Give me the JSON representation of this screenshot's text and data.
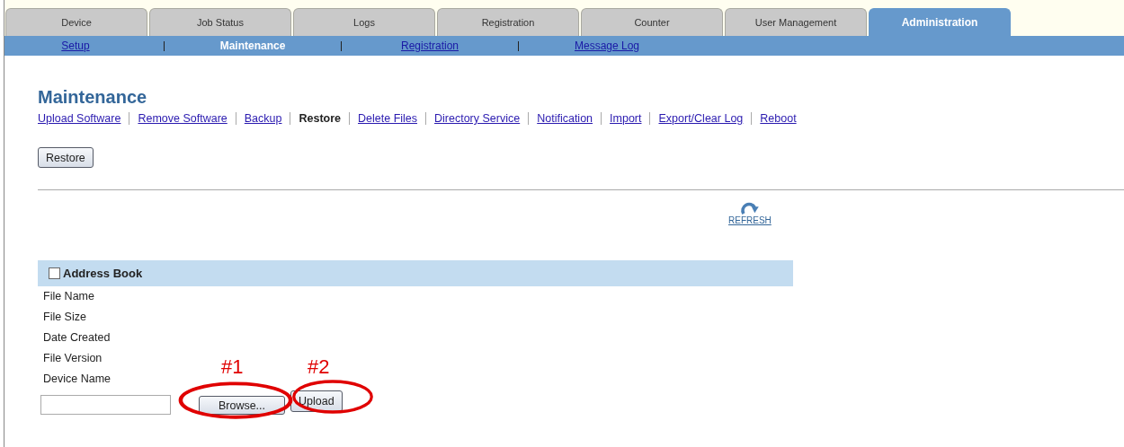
{
  "tabs": [
    {
      "label": "Device",
      "selected": false
    },
    {
      "label": "Job Status",
      "selected": false
    },
    {
      "label": "Logs",
      "selected": false
    },
    {
      "label": "Registration",
      "selected": false
    },
    {
      "label": "Counter",
      "selected": false
    },
    {
      "label": "User Management",
      "selected": false
    },
    {
      "label": "Administration",
      "selected": true
    }
  ],
  "subnav": [
    {
      "label": "Setup",
      "selected": false
    },
    {
      "label": "Maintenance",
      "selected": true
    },
    {
      "label": "Registration",
      "selected": false
    },
    {
      "label": "Message Log",
      "selected": false
    }
  ],
  "page_title": "Maintenance",
  "sublinks": [
    {
      "label": "Upload Software",
      "selected": false
    },
    {
      "label": "Remove Software",
      "selected": false
    },
    {
      "label": "Backup",
      "selected": false
    },
    {
      "label": "Restore",
      "selected": true
    },
    {
      "label": "Delete Files",
      "selected": false
    },
    {
      "label": "Directory Service",
      "selected": false
    },
    {
      "label": "Notification",
      "selected": false
    },
    {
      "label": "Import",
      "selected": false
    },
    {
      "label": "Export/Clear Log",
      "selected": false
    },
    {
      "label": "Reboot",
      "selected": false
    }
  ],
  "restore_button": "Restore",
  "refresh_link": "REFRESH",
  "section": {
    "title": "Address Book",
    "checked": false,
    "fields": [
      "File Name",
      "File Size",
      "Date Created",
      "File Version",
      "Device Name"
    ]
  },
  "browse_button": "Browse...",
  "upload_button": "Upload",
  "annotations": [
    {
      "label": "#1"
    },
    {
      "label": "#2"
    }
  ]
}
